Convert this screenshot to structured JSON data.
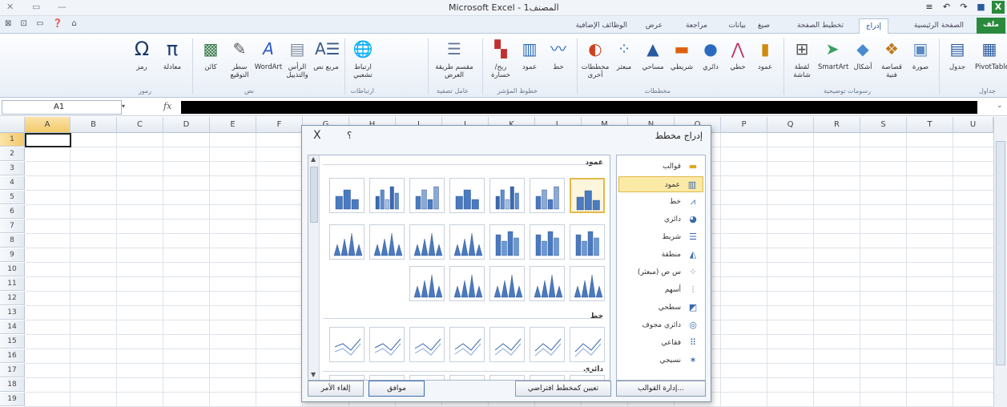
{
  "window": {
    "title": "Microsoft Excel - المصنف1"
  },
  "tabs": [
    {
      "label": "ملف",
      "kind": "file"
    },
    {
      "label": "الصفحة الرئيسية",
      "kind": "normal"
    },
    {
      "label": "إدراج",
      "kind": "active"
    },
    {
      "label": "تخطيط الصفحة",
      "kind": "normal"
    },
    {
      "label": "صيغ",
      "kind": "normal"
    },
    {
      "label": "بيانات",
      "kind": "normal"
    },
    {
      "label": "مراجعة",
      "kind": "normal"
    },
    {
      "label": "عرض",
      "kind": "normal"
    },
    {
      "label": "الوظائف الإضافية",
      "kind": "normal"
    }
  ],
  "ribbon": {
    "buttons": [
      {
        "label": "PivotTable",
        "icon": "pivot-table-icon"
      },
      {
        "label": "جدول",
        "icon": "table-icon"
      },
      {
        "label": "صورة",
        "icon": "picture-icon"
      },
      {
        "label": "قصاصة فنية",
        "icon": "clip-art-icon"
      },
      {
        "label": "أشكال",
        "icon": "shapes-icon"
      },
      {
        "label": "SmartArt",
        "icon": "smartart-icon"
      },
      {
        "label": "لقطة شاشة",
        "icon": "screenshot-icon"
      },
      {
        "label": "عمود",
        "icon": "column-chart-icon"
      },
      {
        "label": "خطي",
        "icon": "line-chart-icon"
      },
      {
        "label": "دائري",
        "icon": "pie-chart-icon"
      },
      {
        "label": "شريطي",
        "icon": "bar-chart-icon"
      },
      {
        "label": "مساحي",
        "icon": "area-chart-icon"
      },
      {
        "label": "مبعثر",
        "icon": "scatter-chart-icon"
      },
      {
        "label": "مخططات أخرى",
        "icon": "other-charts-icon"
      },
      {
        "label": "خط",
        "icon": "sparkline-line-icon"
      },
      {
        "label": "عمود",
        "icon": "sparkline-column-icon"
      },
      {
        "label": "ربح/خسارة",
        "icon": "win-loss-icon"
      },
      {
        "label": "مقسم طريقة العرض",
        "icon": "slicer-icon"
      },
      {
        "label": "ارتباط تشعبي",
        "icon": "hyperlink-icon"
      },
      {
        "label": "مربع نص",
        "icon": "text-box-icon"
      },
      {
        "label": "الرأس والتذييل",
        "icon": "header-footer-icon"
      },
      {
        "label": "WordArt",
        "icon": "wordart-icon"
      },
      {
        "label": "سطر التوقيع",
        "icon": "signature-icon"
      },
      {
        "label": "كائن",
        "icon": "object-icon"
      },
      {
        "label": "معادلة",
        "icon": "equation-icon"
      },
      {
        "label": "رمز",
        "icon": "symbol-icon"
      }
    ],
    "groups": [
      {
        "label": "جداول"
      },
      {
        "label": "رسومات توضيحية"
      },
      {
        "label": "مخططات"
      },
      {
        "label": "خطوط المؤشر"
      },
      {
        "label": "عامل تصفية"
      },
      {
        "label": "ارتباطات"
      },
      {
        "label": "نص"
      },
      {
        "label": "رموز"
      }
    ]
  },
  "formula_bar": {
    "name_box": "A1",
    "fx": "fx"
  },
  "columns": [
    "A",
    "B",
    "C",
    "D",
    "E",
    "F",
    "G",
    "H",
    "I",
    "J",
    "K",
    "L",
    "M",
    "N",
    "O",
    "P",
    "Q",
    "R",
    "S",
    "T",
    "U"
  ],
  "rows": [
    "1",
    "2",
    "3",
    "4",
    "5",
    "6",
    "7",
    "8",
    "9",
    "10",
    "11",
    "12",
    "13",
    "14",
    "15",
    "16",
    "17",
    "18",
    "19"
  ],
  "dialog": {
    "title": "إدراج مخطط",
    "help": "؟",
    "close": "X",
    "categories": [
      {
        "label": "قوالب",
        "icon": "folder-icon"
      },
      {
        "label": "عمود",
        "icon": "column-icon"
      },
      {
        "label": "خط",
        "icon": "line-icon"
      },
      {
        "label": "دائري",
        "icon": "pie-icon"
      },
      {
        "label": "شريط",
        "icon": "bar-icon"
      },
      {
        "label": "منطقة",
        "icon": "area-icon"
      },
      {
        "label": "س ص (مبعثر)",
        "icon": "scatter-icon"
      },
      {
        "label": "أسهم",
        "icon": "stock-icon"
      },
      {
        "label": "سطحي",
        "icon": "surface-icon"
      },
      {
        "label": "دائري مجوف",
        "icon": "doughnut-icon"
      },
      {
        "label": "فقاعي",
        "icon": "bubble-icon"
      },
      {
        "label": "نسيجي",
        "icon": "radar-icon"
      }
    ],
    "selected_category": "عمود",
    "sections": {
      "column": "عمود",
      "line": "خط",
      "pie": "دائري"
    },
    "buttons": {
      "manage": "إدارة القوالب...",
      "set_default": "تعيين كمخطط افتراضي",
      "ok": "موافق",
      "cancel": "إلغاء الأمر"
    }
  },
  "colors": {
    "file_tab": "#2a8a3c",
    "selection": "#fbe9a6",
    "accent": "#1f4e8a"
  }
}
